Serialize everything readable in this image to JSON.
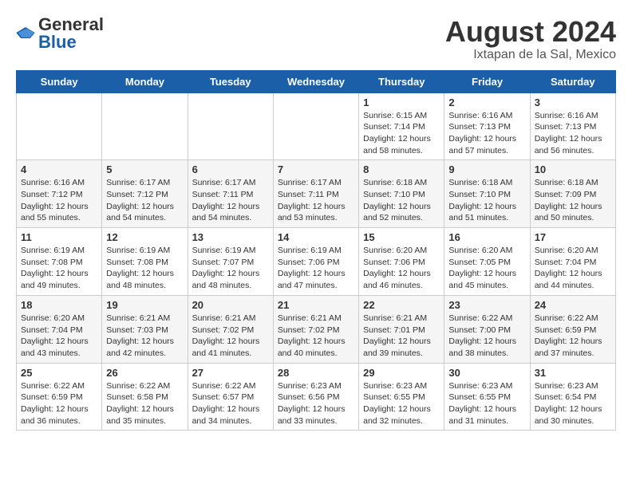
{
  "header": {
    "logo_general": "General",
    "logo_blue": "Blue",
    "month_title": "August 2024",
    "location": "Ixtapan de la Sal, Mexico"
  },
  "weekdays": [
    "Sunday",
    "Monday",
    "Tuesday",
    "Wednesday",
    "Thursday",
    "Friday",
    "Saturday"
  ],
  "weeks": [
    [
      {
        "day": "",
        "info": ""
      },
      {
        "day": "",
        "info": ""
      },
      {
        "day": "",
        "info": ""
      },
      {
        "day": "",
        "info": ""
      },
      {
        "day": "1",
        "info": "Sunrise: 6:15 AM\nSunset: 7:14 PM\nDaylight: 12 hours\nand 58 minutes."
      },
      {
        "day": "2",
        "info": "Sunrise: 6:16 AM\nSunset: 7:13 PM\nDaylight: 12 hours\nand 57 minutes."
      },
      {
        "day": "3",
        "info": "Sunrise: 6:16 AM\nSunset: 7:13 PM\nDaylight: 12 hours\nand 56 minutes."
      }
    ],
    [
      {
        "day": "4",
        "info": "Sunrise: 6:16 AM\nSunset: 7:12 PM\nDaylight: 12 hours\nand 55 minutes."
      },
      {
        "day": "5",
        "info": "Sunrise: 6:17 AM\nSunset: 7:12 PM\nDaylight: 12 hours\nand 54 minutes."
      },
      {
        "day": "6",
        "info": "Sunrise: 6:17 AM\nSunset: 7:11 PM\nDaylight: 12 hours\nand 54 minutes."
      },
      {
        "day": "7",
        "info": "Sunrise: 6:17 AM\nSunset: 7:11 PM\nDaylight: 12 hours\nand 53 minutes."
      },
      {
        "day": "8",
        "info": "Sunrise: 6:18 AM\nSunset: 7:10 PM\nDaylight: 12 hours\nand 52 minutes."
      },
      {
        "day": "9",
        "info": "Sunrise: 6:18 AM\nSunset: 7:10 PM\nDaylight: 12 hours\nand 51 minutes."
      },
      {
        "day": "10",
        "info": "Sunrise: 6:18 AM\nSunset: 7:09 PM\nDaylight: 12 hours\nand 50 minutes."
      }
    ],
    [
      {
        "day": "11",
        "info": "Sunrise: 6:19 AM\nSunset: 7:08 PM\nDaylight: 12 hours\nand 49 minutes."
      },
      {
        "day": "12",
        "info": "Sunrise: 6:19 AM\nSunset: 7:08 PM\nDaylight: 12 hours\nand 48 minutes."
      },
      {
        "day": "13",
        "info": "Sunrise: 6:19 AM\nSunset: 7:07 PM\nDaylight: 12 hours\nand 48 minutes."
      },
      {
        "day": "14",
        "info": "Sunrise: 6:19 AM\nSunset: 7:06 PM\nDaylight: 12 hours\nand 47 minutes."
      },
      {
        "day": "15",
        "info": "Sunrise: 6:20 AM\nSunset: 7:06 PM\nDaylight: 12 hours\nand 46 minutes."
      },
      {
        "day": "16",
        "info": "Sunrise: 6:20 AM\nSunset: 7:05 PM\nDaylight: 12 hours\nand 45 minutes."
      },
      {
        "day": "17",
        "info": "Sunrise: 6:20 AM\nSunset: 7:04 PM\nDaylight: 12 hours\nand 44 minutes."
      }
    ],
    [
      {
        "day": "18",
        "info": "Sunrise: 6:20 AM\nSunset: 7:04 PM\nDaylight: 12 hours\nand 43 minutes."
      },
      {
        "day": "19",
        "info": "Sunrise: 6:21 AM\nSunset: 7:03 PM\nDaylight: 12 hours\nand 42 minutes."
      },
      {
        "day": "20",
        "info": "Sunrise: 6:21 AM\nSunset: 7:02 PM\nDaylight: 12 hours\nand 41 minutes."
      },
      {
        "day": "21",
        "info": "Sunrise: 6:21 AM\nSunset: 7:02 PM\nDaylight: 12 hours\nand 40 minutes."
      },
      {
        "day": "22",
        "info": "Sunrise: 6:21 AM\nSunset: 7:01 PM\nDaylight: 12 hours\nand 39 minutes."
      },
      {
        "day": "23",
        "info": "Sunrise: 6:22 AM\nSunset: 7:00 PM\nDaylight: 12 hours\nand 38 minutes."
      },
      {
        "day": "24",
        "info": "Sunrise: 6:22 AM\nSunset: 6:59 PM\nDaylight: 12 hours\nand 37 minutes."
      }
    ],
    [
      {
        "day": "25",
        "info": "Sunrise: 6:22 AM\nSunset: 6:59 PM\nDaylight: 12 hours\nand 36 minutes."
      },
      {
        "day": "26",
        "info": "Sunrise: 6:22 AM\nSunset: 6:58 PM\nDaylight: 12 hours\nand 35 minutes."
      },
      {
        "day": "27",
        "info": "Sunrise: 6:22 AM\nSunset: 6:57 PM\nDaylight: 12 hours\nand 34 minutes."
      },
      {
        "day": "28",
        "info": "Sunrise: 6:23 AM\nSunset: 6:56 PM\nDaylight: 12 hours\nand 33 minutes."
      },
      {
        "day": "29",
        "info": "Sunrise: 6:23 AM\nSunset: 6:55 PM\nDaylight: 12 hours\nand 32 minutes."
      },
      {
        "day": "30",
        "info": "Sunrise: 6:23 AM\nSunset: 6:55 PM\nDaylight: 12 hours\nand 31 minutes."
      },
      {
        "day": "31",
        "info": "Sunrise: 6:23 AM\nSunset: 6:54 PM\nDaylight: 12 hours\nand 30 minutes."
      }
    ]
  ]
}
